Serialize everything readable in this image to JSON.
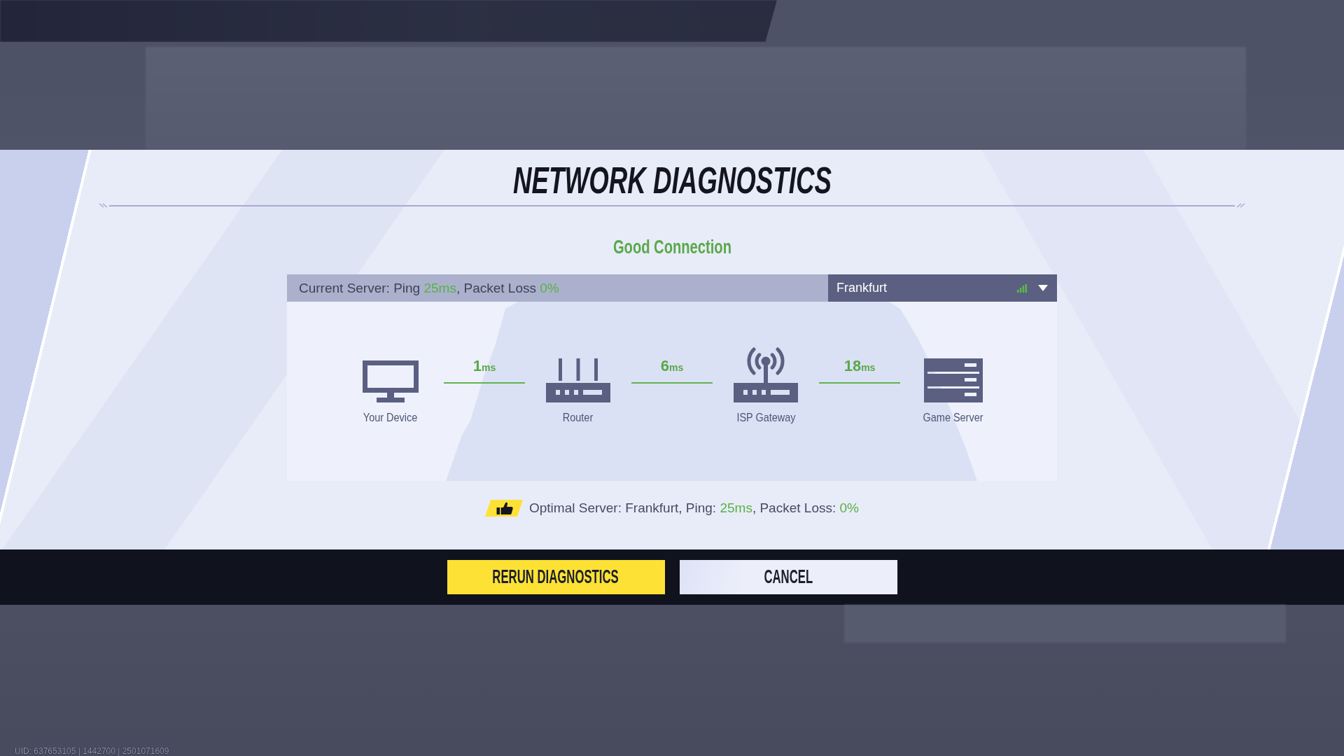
{
  "title": "NETWORK DIAGNOSTICS",
  "status": "Good Connection",
  "current_server": {
    "parts": [
      {
        "text": "Current Server: Ping ",
        "highlight": false
      },
      {
        "text": "25ms",
        "highlight": true
      },
      {
        "text": ", Packet Loss ",
        "highlight": false
      },
      {
        "text": "0%",
        "highlight": true
      }
    ]
  },
  "server_select": {
    "value": "Frankfurt"
  },
  "route": {
    "nodes": [
      {
        "kind": "device",
        "label": "Your Device"
      },
      {
        "kind": "router",
        "label": "Router"
      },
      {
        "kind": "gateway",
        "label": "ISP Gateway"
      },
      {
        "kind": "server",
        "label": "Game Server"
      }
    ],
    "links": [
      {
        "value": "1",
        "unit": "ms"
      },
      {
        "value": "6",
        "unit": "ms"
      },
      {
        "value": "18",
        "unit": "ms"
      }
    ]
  },
  "optimal_server": {
    "parts": [
      {
        "text": "Optimal Server: Frankfurt, Ping: ",
        "highlight": false
      },
      {
        "text": "25ms",
        "highlight": true
      },
      {
        "text": ", Packet Loss: ",
        "highlight": false
      },
      {
        "text": "0%",
        "highlight": true
      }
    ]
  },
  "buttons": [
    {
      "label": "RERUN DIAGNOSTICS",
      "kind": "primary"
    },
    {
      "label": "CANCEL",
      "kind": "secondary"
    }
  ],
  "footer": {
    "uid": "UID: 637653105 | 1442700 | 2501071609"
  }
}
